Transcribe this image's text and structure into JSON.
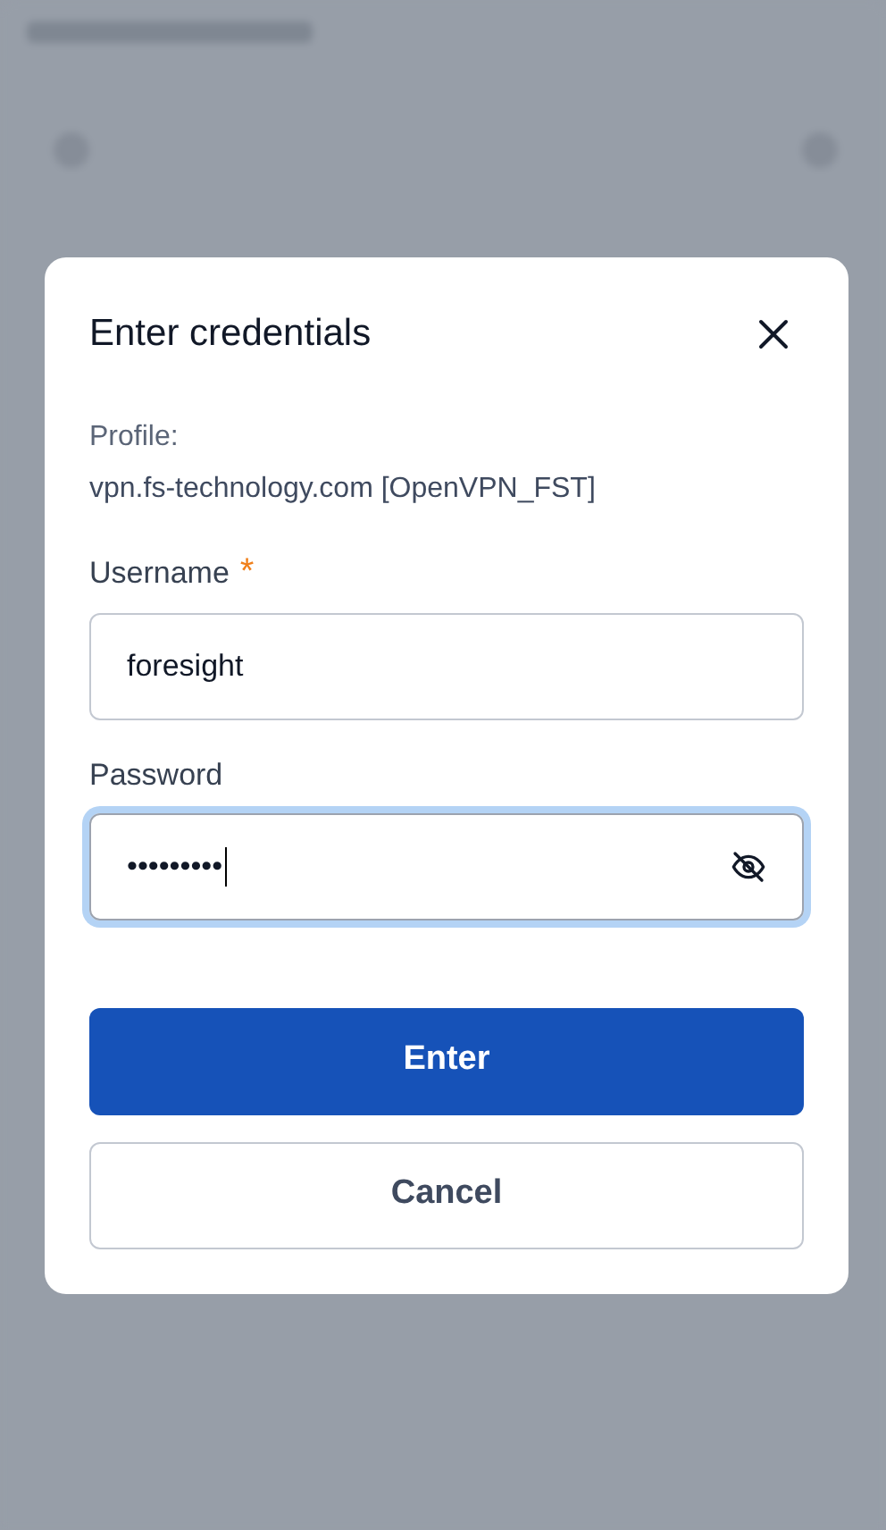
{
  "dialog": {
    "title": "Enter credentials",
    "profile": {
      "label": "Profile:",
      "value": "vpn.fs-technology.com [OpenVPN_FST]"
    },
    "fields": [
      {
        "kind": "text",
        "label": "Username",
        "required_mark": "*",
        "value": "foresight",
        "focused": false
      },
      {
        "kind": "password",
        "label": "Password",
        "value": "•••••••••",
        "focused": true
      }
    ],
    "buttons": [
      {
        "label": "Enter",
        "primary": true
      },
      {
        "label": "Cancel",
        "primary": false
      }
    ]
  }
}
